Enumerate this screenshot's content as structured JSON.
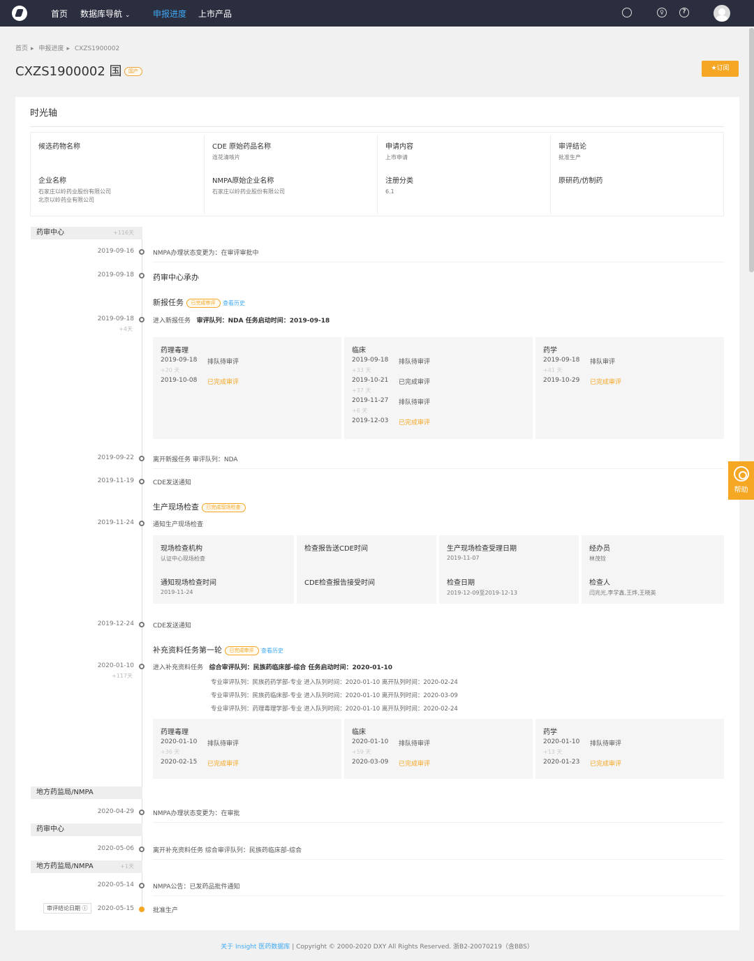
{
  "nav": {
    "items": [
      "首页",
      "数据库导航",
      "申报进度",
      "上市产品"
    ],
    "active_index": 2,
    "dropdown": "⌄"
  },
  "header_icons": [
    "search-icon",
    "lightbulb-icon",
    "help-icon",
    "avatar"
  ],
  "breadcrumb": [
    "首页",
    "申报进度",
    "CXZS1900002"
  ],
  "title": "CXZS1900002 国",
  "tag": "国产",
  "subscribe_label": "订阅",
  "section_title": "时光轴",
  "info": [
    {
      "label": "候选药物名称",
      "value": ""
    },
    {
      "label": "CDE 原始药品名称",
      "value": "连花清咳片"
    },
    {
      "label": "申请内容",
      "value": "上市申请"
    },
    {
      "label": "审评结论",
      "value": "批准生产"
    },
    {
      "label": "企业名称",
      "value": "石家庄以岭药业股份有限公司\n北京以岭药业有限公司"
    },
    {
      "label": "NMPA原始企业名称",
      "value": "石家庄以岭药业股份有限公司"
    },
    {
      "label": "注册分类",
      "value": "6.1"
    },
    {
      "label": "原研药/仿制药",
      "value": ""
    }
  ],
  "agencies": [
    {
      "name": "药审中心",
      "plus": "+116天"
    },
    {
      "name": "地方药监局/NMPA",
      "plus": ""
    },
    {
      "name": "药审中心",
      "plus": ""
    },
    {
      "name": "地方药监局/NMPA",
      "plus": "+1天"
    }
  ],
  "events": [
    {
      "date": "2019-09-16",
      "sub": "",
      "text": "NMPA办理状态变更为：在审评审批中"
    },
    {
      "date": "2019-09-18",
      "sub": "",
      "text": "药审中心承办"
    },
    {
      "date": "2019-09-18",
      "sub": "+4天",
      "text": "进入新报任务",
      "extra": "审评队列：NDA    任务启动时间：2019-09-18"
    },
    {
      "date": "2019-09-22",
      "sub": "",
      "text": "离开新报任务    审评队列：NDA"
    },
    {
      "date": "2019-11-19",
      "sub": "",
      "text": "CDE发送通知"
    },
    {
      "date": "2019-11-24",
      "sub": "",
      "text": "通知生产现场检查"
    },
    {
      "date": "2019-12-24",
      "sub": "",
      "text": "CDE发送通知"
    },
    {
      "date": "2020-01-10",
      "sub": "+117天",
      "text": "进入补充资料任务",
      "extra": "综合审评队列：民族药临床部-综合    任务启动时间：2020-01-10"
    },
    {
      "date": "2020-04-29",
      "sub": "",
      "text": "NMPA办理状态变更为：在审批"
    },
    {
      "date": "2020-05-06",
      "sub": "",
      "text": "离开补充资料任务    综合审评队列：民族药临床部-综合"
    },
    {
      "date": "2020-05-14",
      "sub": "",
      "text": "NMPA公告：已发药品批件通知"
    },
    {
      "date": "2020-05-15",
      "sub": "",
      "text": "批准生产"
    }
  ],
  "task_new": {
    "title": "新报任务",
    "status": "已完成审评",
    "history": "查看历史"
  },
  "task_insp": {
    "title": "生产现场检查",
    "status": "已完成现场检查"
  },
  "task_supp": {
    "title": "补充资料任务第一轮",
    "status": "已完成审评",
    "history": "查看历史"
  },
  "review_boxes_1": [
    {
      "title": "药理毒理",
      "rows": [
        {
          "d": "2019-09-18",
          "s": "排队待审评",
          "y": false,
          "p": "+20 天"
        },
        {
          "d": "2019-10-08",
          "s": "已完成审评",
          "y": true,
          "p": ""
        }
      ]
    },
    {
      "title": "临床",
      "rows": [
        {
          "d": "2019-09-18",
          "s": "排队待审评",
          "y": false,
          "p": "+33 天"
        },
        {
          "d": "2019-10-21",
          "s": "已完成审评",
          "y": false,
          "p": "+37 天"
        },
        {
          "d": "2019-11-27",
          "s": "排队待审评",
          "y": false,
          "p": "+6 天"
        },
        {
          "d": "2019-12-03",
          "s": "已完成审评",
          "y": true,
          "p": ""
        }
      ]
    },
    {
      "title": "药学",
      "rows": [
        {
          "d": "2019-09-18",
          "s": "排队审评",
          "y": false,
          "p": "+41 天"
        },
        {
          "d": "2019-10-29",
          "s": "已完成审评",
          "y": true,
          "p": ""
        }
      ]
    }
  ],
  "inspection": [
    {
      "label": "现场检查机构",
      "value": "认证中心现场检查"
    },
    {
      "label": "检查报告送CDE时间",
      "value": ""
    },
    {
      "label": "生产现场检查受理日期",
      "value": "2019-11-07"
    },
    {
      "label": "经办员",
      "value": "林茂铨"
    },
    {
      "label": "通知现场检查时间",
      "value": "2019-11-24"
    },
    {
      "label": "CDE检查报告接受时间",
      "value": ""
    },
    {
      "label": "检查日期",
      "value": "2019-12-09至2019-12-13"
    },
    {
      "label": "检查人",
      "value": "闫兆光,李学鑫,王烨,王晓英"
    }
  ],
  "sub_queues": [
    "专业审评队列：民族药药学部-专业    进入队列时间：2020-01-10    离开队列时间：2020-02-24",
    "专业审评队列：民族药临床部-专业    进入队列时间：2020-01-10    离开队列时间：2020-03-09",
    "专业审评队列：药理毒理学部-专业    进入队列时间：2020-01-10    离开队列时间：2020-02-24"
  ],
  "review_boxes_2": [
    {
      "title": "药理毒理",
      "rows": [
        {
          "d": "2020-01-10",
          "s": "排队待审评",
          "y": false,
          "p": "+36 天"
        },
        {
          "d": "2020-02-15",
          "s": "已完成审评",
          "y": true,
          "p": ""
        }
      ]
    },
    {
      "title": "临床",
      "rows": [
        {
          "d": "2020-01-10",
          "s": "排队待审评",
          "y": false,
          "p": "+59 天"
        },
        {
          "d": "2020-03-09",
          "s": "已完成审评",
          "y": true,
          "p": ""
        }
      ]
    },
    {
      "title": "药学",
      "rows": [
        {
          "d": "2020-01-10",
          "s": "排队待审评",
          "y": false,
          "p": "+13 天"
        },
        {
          "d": "2020-01-23",
          "s": "已完成审评",
          "y": true,
          "p": ""
        }
      ]
    }
  ],
  "conclusion_date_label": "审评结论日期",
  "help_label": "帮助",
  "footer": {
    "link": "关于 Insight 医药数据库",
    "text": " | Copyright © 2000-2020 DXY All Rights Reserved. 浙B2-20070219（含BBS）"
  },
  "colors": {
    "accent": "#3fa9f5",
    "gold": "#f5a623",
    "topbar": "#2b2e3e"
  }
}
